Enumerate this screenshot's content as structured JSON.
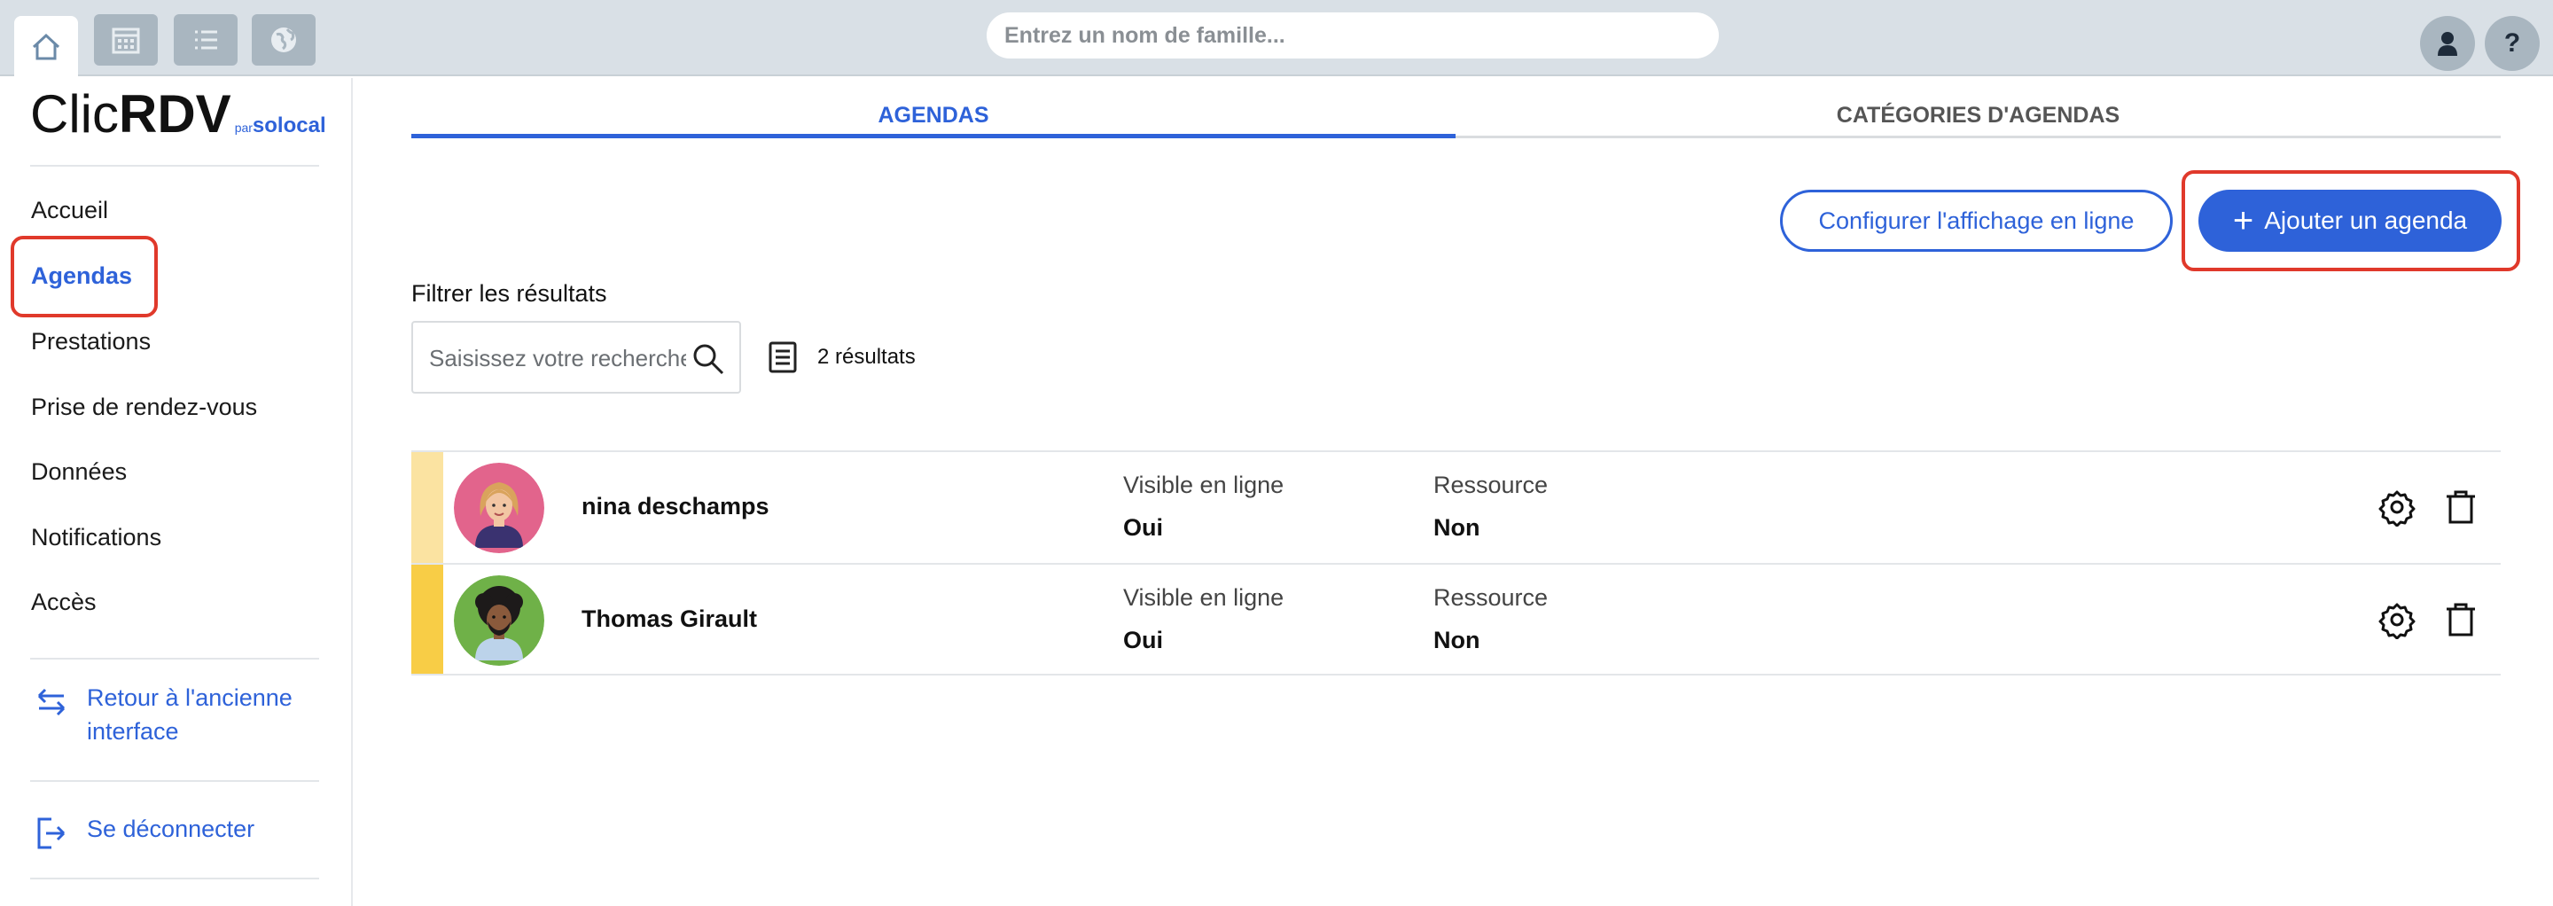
{
  "topbar": {
    "search_placeholder": "Entrez un nom de famille...",
    "icons": [
      "home-icon",
      "calendar-icon",
      "list-icon",
      "globe-icon"
    ],
    "help_label": "?"
  },
  "sidebar": {
    "logo_clic": "Clic",
    "logo_rdv": "RDV",
    "logo_par": "par",
    "logo_solocal": "solocal",
    "items": [
      {
        "label": "Accueil"
      },
      {
        "label": "Agendas"
      },
      {
        "label": "Prestations"
      },
      {
        "label": "Prise de rendez-vous"
      },
      {
        "label": "Données"
      },
      {
        "label": "Notifications"
      },
      {
        "label": "Accès"
      }
    ],
    "back_link": "Retour à l'ancienne interface",
    "logout": "Se déconnecter"
  },
  "tabs": [
    {
      "label": "AGENDAS"
    },
    {
      "label": "CATÉGORIES D'AGENDAS"
    }
  ],
  "actions": {
    "configure": "Configurer l'affichage en ligne",
    "add_plus": "+",
    "add": "Ajouter un agenda"
  },
  "filter": {
    "label": "Filtrer les résultats",
    "placeholder": "Saisissez votre recherche",
    "results": "2 résultats"
  },
  "agendas": [
    {
      "name": "nina deschamps",
      "color": "#fbe3a1",
      "visible_label": "Visible en ligne",
      "visible_value": "Oui",
      "resource_label": "Ressource",
      "resource_value": "Non"
    },
    {
      "name": "Thomas Girault",
      "color": "#f8cd46",
      "visible_label": "Visible en ligne",
      "visible_value": "Oui",
      "resource_label": "Ressource",
      "resource_value": "Non"
    }
  ],
  "colors": {
    "accent": "#2e62d9",
    "highlight": "#e0392b"
  }
}
